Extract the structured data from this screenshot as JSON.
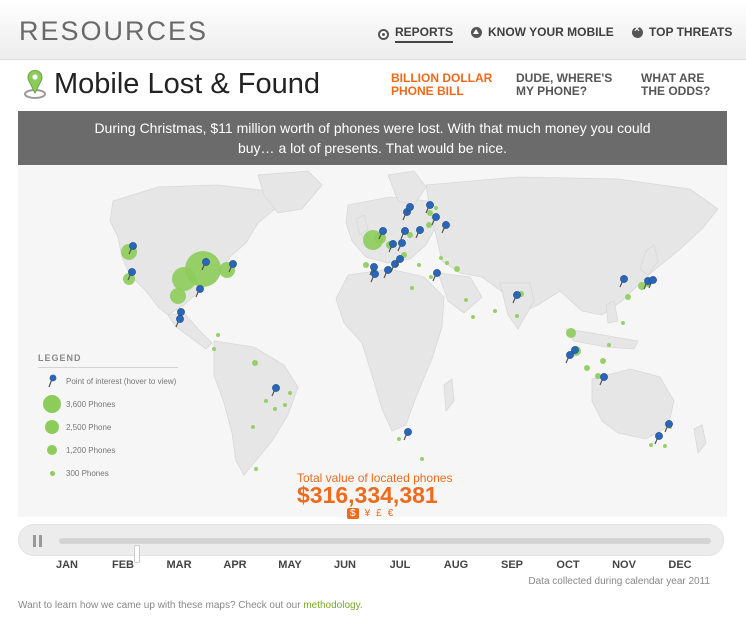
{
  "header": {
    "brand": "RESOURCES",
    "nav": [
      {
        "label": "REPORTS",
        "icon": "radio-target-icon",
        "active": true
      },
      {
        "label": "KNOW YOUR MOBILE",
        "icon": "up-arrow-circle-icon"
      },
      {
        "label": "TOP THREATS",
        "icon": "x-circle-icon"
      }
    ]
  },
  "page": {
    "title": "Mobile Lost & Found",
    "title_icon": "map-pin-icon",
    "subnav": [
      {
        "line1": "BILLION DOLLAR",
        "line2": "PHONE BILL",
        "active": true
      },
      {
        "line1": "DUDE, WHERE'S",
        "line2": "MY PHONE?"
      },
      {
        "line1": "WHAT ARE",
        "line2": "THE ODDS?"
      }
    ]
  },
  "banner": {
    "text": "During Christmas, $11 million worth of phones were lost. With that much money you could buy… a lot of presents. That would be nice."
  },
  "legend": {
    "title": "LEGEND",
    "items": [
      {
        "label": "Point of interest (hover to view)",
        "type": "pin"
      },
      {
        "label": "3,600 Phones",
        "phones": 3600
      },
      {
        "label": "2,500 Phone",
        "phones": 2500
      },
      {
        "label": "1,200 Phones",
        "phones": 1200
      },
      {
        "label": "300 Phones",
        "phones": 300
      }
    ]
  },
  "total": {
    "label": "Total value of located phones",
    "value": "$316,334,381",
    "currencies": [
      "$",
      "¥",
      "£",
      "€"
    ],
    "selected_currency": "$"
  },
  "timeline": {
    "months": [
      "JAN",
      "FEB",
      "MAR",
      "APR",
      "MAY",
      "JUN",
      "JUL",
      "AUG",
      "SEP",
      "OCT",
      "NOV",
      "DEC"
    ],
    "position": 0.12,
    "note": "Data collected during calendar year 2011"
  },
  "footer": {
    "text": "Want to learn how we came up with these maps? Check out our ",
    "link": "methodology",
    "end": "."
  },
  "colors": {
    "accent": "#ef6a1a",
    "bubble": "#8dcc5a",
    "pin": "#2a66b8",
    "land": "#e6e6e6",
    "banner": "#6b6b6b",
    "link": "#7aaa24"
  }
}
